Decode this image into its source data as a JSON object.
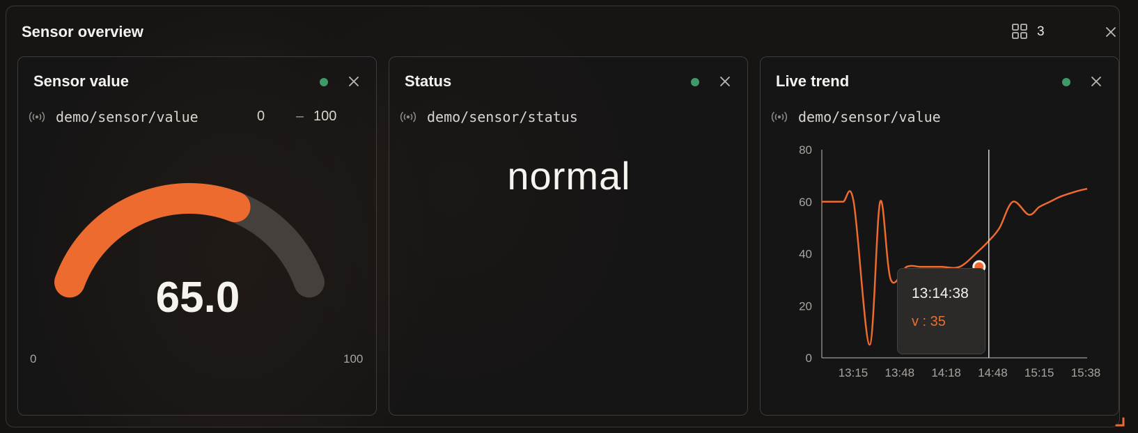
{
  "window": {
    "title": "Sensor overview",
    "widget_count": "3",
    "icons": {
      "layout": "grid-icon",
      "close": "close-icon",
      "resize": "resize-handle-icon"
    }
  },
  "colors": {
    "accent": "#ee6b2f",
    "online": "#3f9a69",
    "track": "#45403c"
  },
  "cards": [
    {
      "title": "Sensor value",
      "topic": "demo/sensor/value",
      "range_min": "0",
      "range_dash": "–",
      "range_max": "100",
      "gauge": {
        "value": 65.0,
        "display": "65.0",
        "min": 0,
        "max": 100,
        "min_label": "0",
        "max_label": "100"
      }
    },
    {
      "title": "Status",
      "topic": "demo/sensor/status",
      "value": "normal"
    },
    {
      "title": "Live trend",
      "topic": "demo/sensor/value",
      "tooltip": {
        "time": "13:14:38",
        "value": "v : 35"
      }
    }
  ],
  "chart_data": {
    "type": "line",
    "title": "",
    "xlabel": "",
    "ylabel": "",
    "ylim": [
      0,
      80
    ],
    "yticks": [
      "0",
      "20",
      "40",
      "60",
      "80"
    ],
    "xticks": [
      "13:15",
      "13:48",
      "14:18",
      "14:48",
      "15:15",
      "15:38"
    ],
    "grid": false,
    "series": [
      {
        "x": [
          0,
          0.04,
          0.08,
          0.12,
          0.18,
          0.22,
          0.26,
          0.32,
          0.37,
          0.41,
          0.45,
          0.52,
          0.59,
          0.63,
          0.67,
          0.72,
          0.78,
          0.82,
          0.86,
          0.9,
          0.96,
          1.0
        ],
        "values": [
          60,
          60,
          60,
          60,
          5,
          60,
          30,
          35,
          35,
          35,
          35,
          35,
          41,
          45,
          50,
          60,
          55,
          58,
          60,
          62,
          64,
          65
        ]
      }
    ],
    "highlight": {
      "x": 0.59,
      "value": 35
    }
  }
}
